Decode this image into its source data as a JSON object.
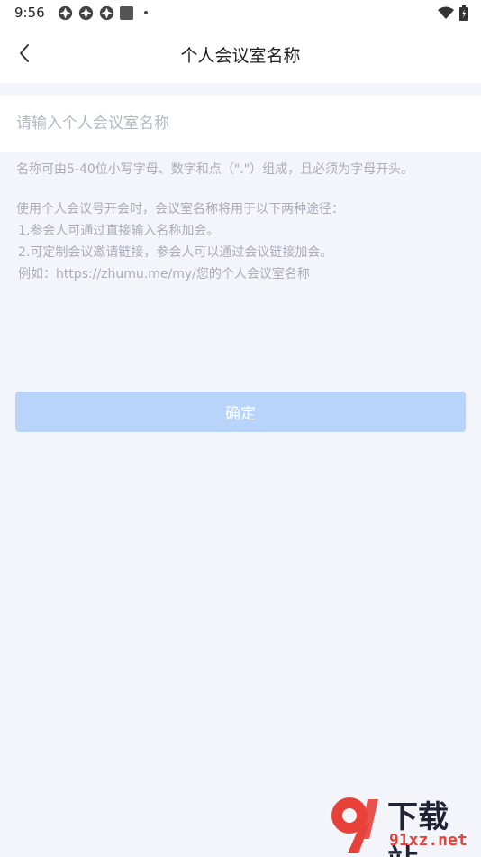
{
  "status_bar": {
    "time": "9:56",
    "icons": [
      "app-notification-icon",
      "app-notification-icon",
      "app-notification-icon",
      "square-notification-icon",
      "dot-icon"
    ],
    "right_icons": [
      "wifi-icon",
      "battery-icon"
    ]
  },
  "header": {
    "back_icon": "chevron-left-icon",
    "title": "个人会议室名称"
  },
  "form": {
    "input_value": "",
    "input_placeholder": "请输入个人会议室名称",
    "hint": "名称可由5-40位小写字母、数字和点（\".\"）组成，且必须为字母开头。"
  },
  "usage": {
    "intro": "使用个人会议号开会时，会议室名称将用于以下两种途径：",
    "items": [
      "1.参会人可通过直接输入名称加会。",
      "2.可定制会议邀请链接，参会人可以通过会议链接加会。"
    ],
    "example": "例如：https://zhumu.me/my/您的个人会议室名称"
  },
  "actions": {
    "confirm_label": "确定"
  },
  "watermark": {
    "top": "下载站",
    "bottom": "91xz.net"
  },
  "colors": {
    "accent_disabled": "#b8d4fb",
    "background": "#f4f5fa",
    "hint_text": "#a8adb8",
    "watermark_red": "#e8413a"
  }
}
